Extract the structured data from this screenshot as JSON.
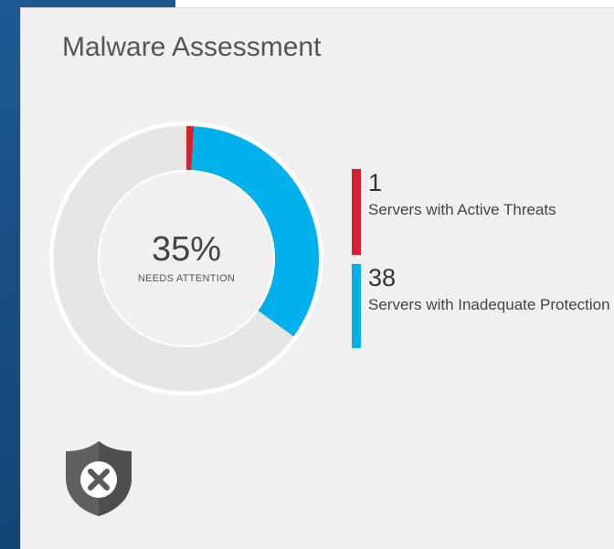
{
  "tile": {
    "title": "Malware Assessment",
    "icon": "shield-x-icon"
  },
  "donut": {
    "percent_label": "35%",
    "caption": "NEEDS ATTENTION",
    "needs_attention_fraction": 0.35,
    "segments": [
      {
        "name": "Servers with Active Threats",
        "fraction": 0.009,
        "color": "#d9202f"
      },
      {
        "name": "Servers with Inadequate Protection",
        "fraction": 0.341,
        "color": "#00b1eb"
      }
    ],
    "track_color": "#e6e6e6"
  },
  "legend": [
    {
      "value": "1",
      "label": "Servers with Active Threats",
      "color": "#d9202f"
    },
    {
      "value": "38",
      "label": "Servers with Inadequate Protection",
      "color": "#00b1eb"
    }
  ]
}
